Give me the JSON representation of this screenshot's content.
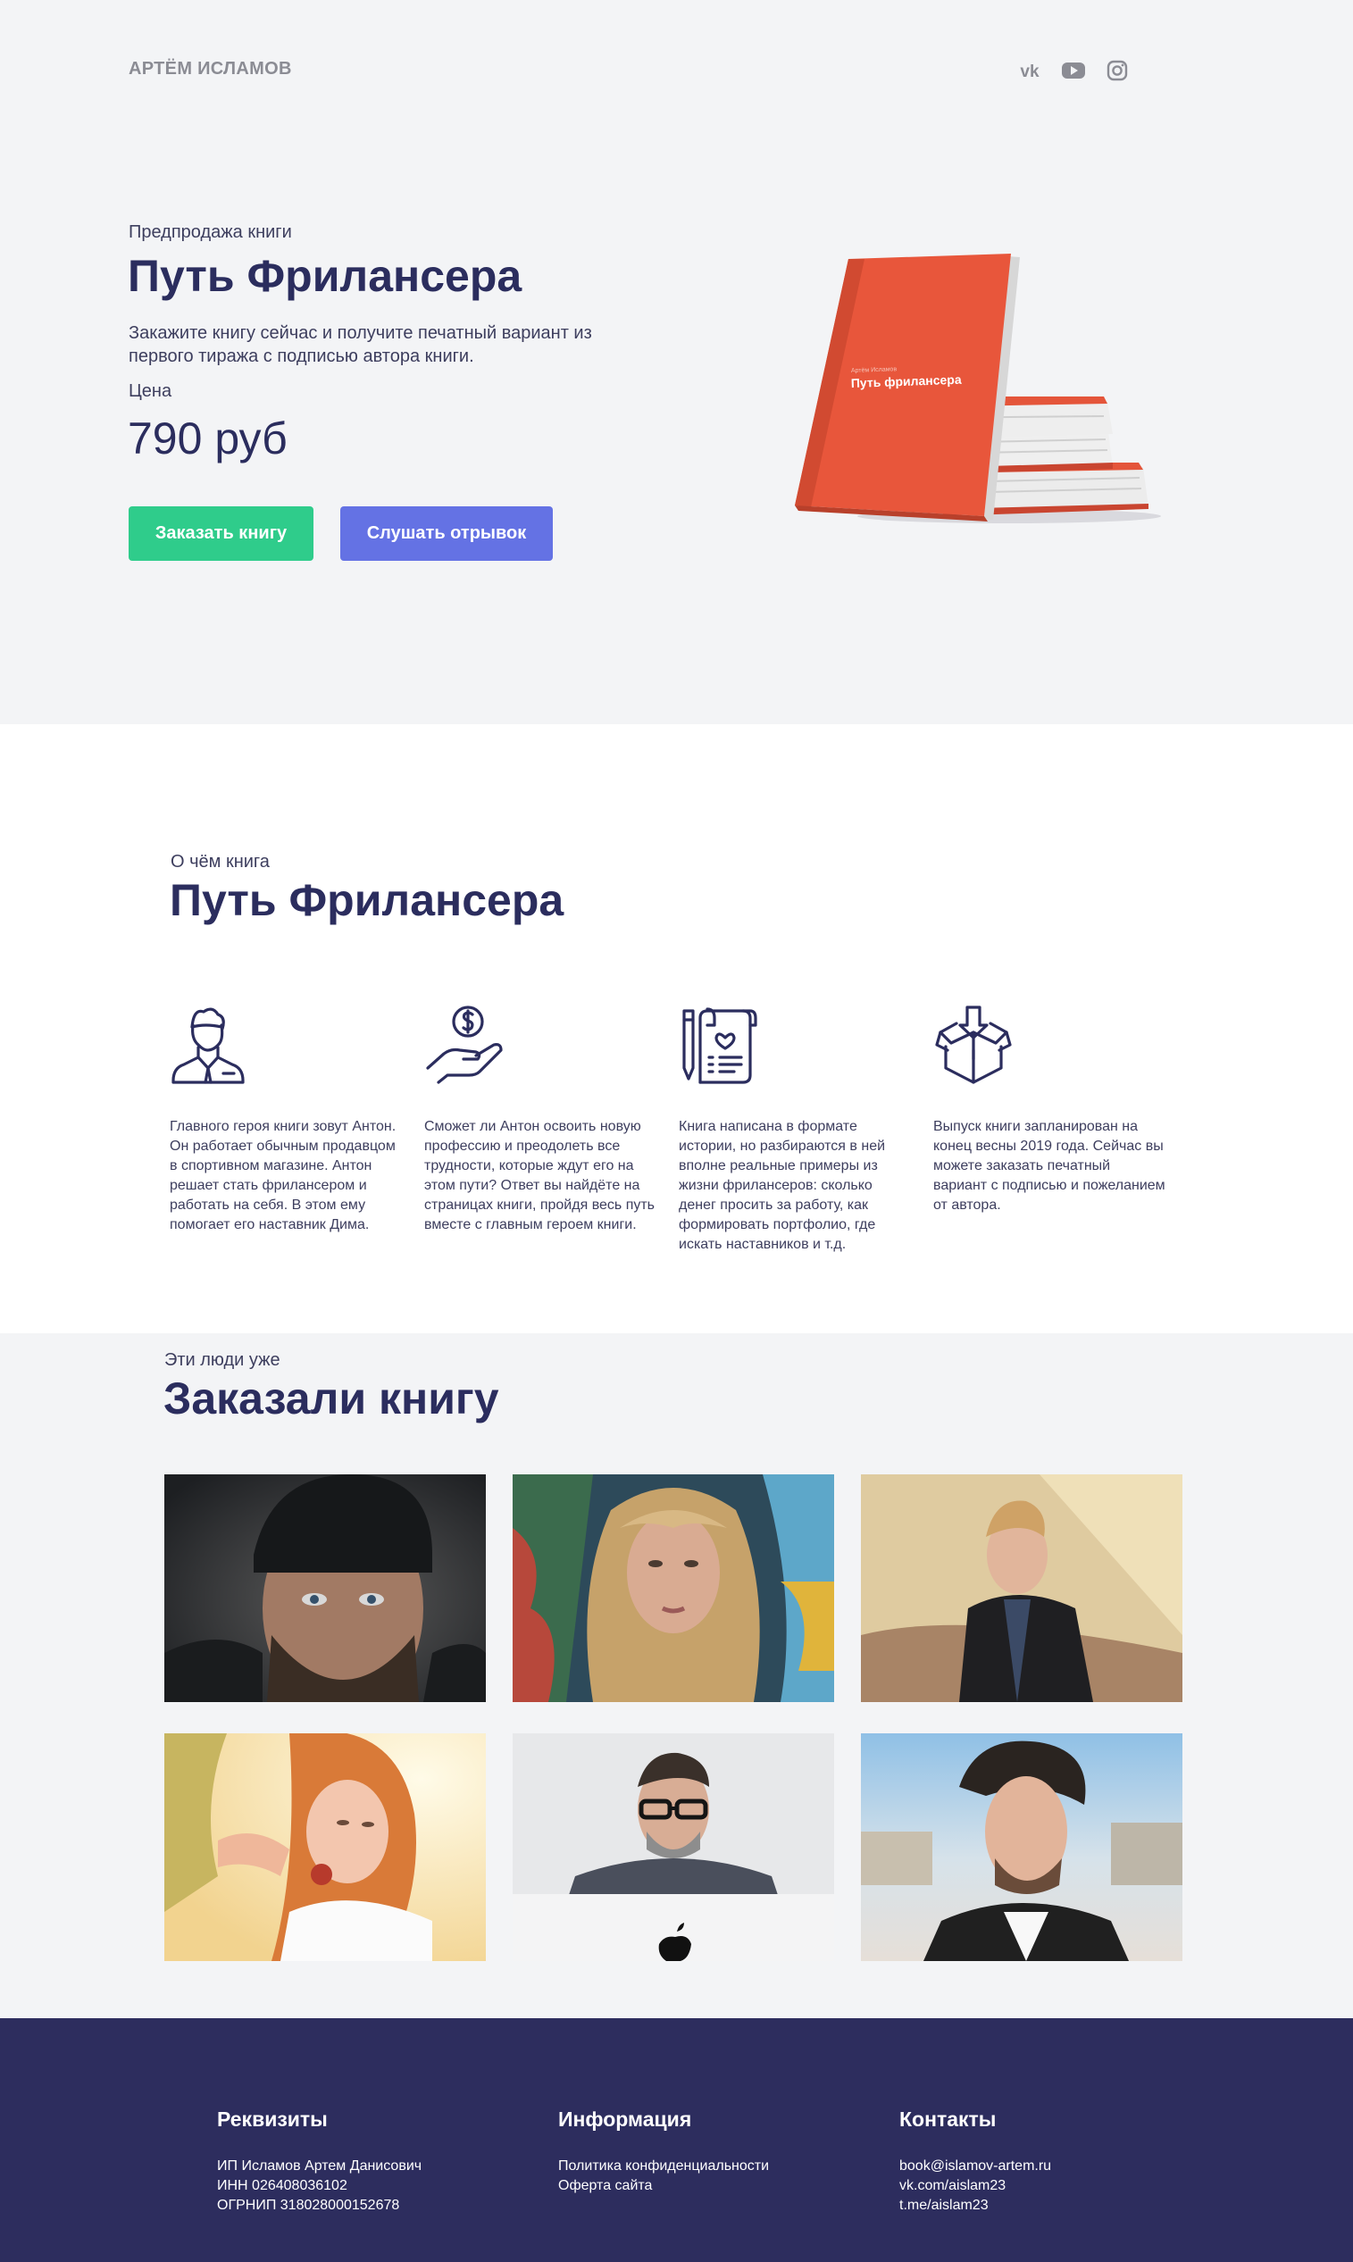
{
  "header": {
    "logo": "АРТЁМ ИСЛАМОВ",
    "social": [
      {
        "icon": "vk-icon"
      },
      {
        "icon": "youtube-icon"
      },
      {
        "icon": "instagram-icon"
      }
    ]
  },
  "hero": {
    "pretitle": "Предпродажа книги",
    "title": "Путь Фрилансера",
    "description": "Закажите книгу сейчас и получите печатный вариант из первого тиража с подписью автора книги.",
    "price_label": "Цена",
    "price": "790 руб",
    "order_button": "Заказать книгу",
    "listen_button": "Слушать отрывок",
    "book_cover": {
      "author": "Артём Исламов",
      "title": "Путь фрилансера",
      "color": "#e8563b"
    }
  },
  "about": {
    "pretitle": "О чём книга",
    "title": "Путь Фрилансера",
    "features": [
      {
        "icon": "businessman-icon",
        "text": "Главного героя книги зовут Антон. Он работает обычным продавцом в спортивном магазине. Антон решает стать фрилансером и работать на себя. В этом ему помогает его наставник Дима."
      },
      {
        "icon": "hand-coin-icon",
        "text": "Сможет ли Антон освоить новую профессию и преодолеть все трудности, которые ждут его на этом пути? Ответ вы найдёте на страницах книги, пройдя весь путь вместе с главным героем книги."
      },
      {
        "icon": "scroll-pen-icon",
        "text": "Книга написана в формате истории, но разбираются в ней вполне реальные примеры из жизни фрилансеров: сколько денег просить за работу, как формировать портфолио, где искать наставников и т.д."
      },
      {
        "icon": "box-download-icon",
        "text": "Выпуск книги запланирован на конец весны 2019 года. Сейчас вы можете заказать печатный вариант с подписью и пожеланием от автора."
      }
    ]
  },
  "customers": {
    "pretitle": "Эти люди уже",
    "title": "Заказали книгу"
  },
  "footer": {
    "columns": [
      {
        "title": "Реквизиты",
        "lines": [
          "ИП Исламов Артем Данисович",
          "ИНН 026408036102",
          "ОГРНИП 318028000152678"
        ]
      },
      {
        "title": "Информация",
        "lines": [
          "Политика конфиденциальности",
          "Оферта сайта"
        ]
      },
      {
        "title": "Контакты",
        "lines": [
          "book@islamov-artem.ru",
          "vk.com/aislam23",
          "t.me/aislam23"
        ]
      }
    ]
  },
  "colors": {
    "hero_bg": "#f3f4f6",
    "heading": "#2b2d5e",
    "order_button": "#2fcc8b",
    "listen_button": "#6472e4",
    "footer_bg": "#2d2d5e"
  }
}
